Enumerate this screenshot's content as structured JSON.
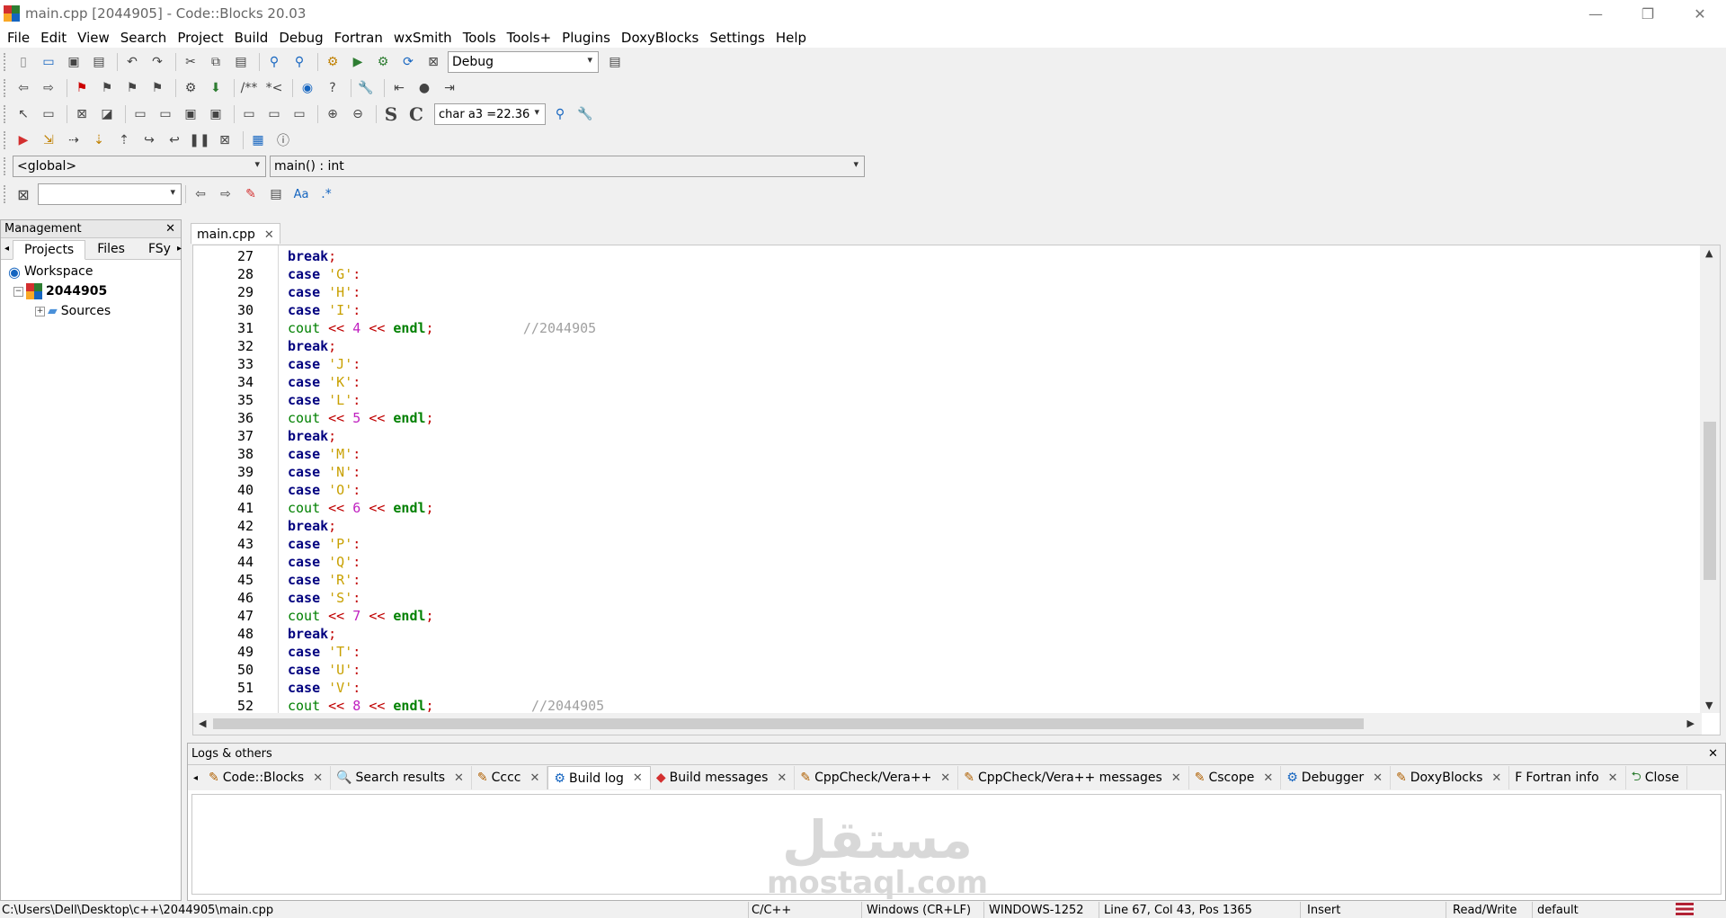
{
  "window": {
    "title": "main.cpp [2044905] - Code::Blocks 20.03",
    "controls": [
      "—",
      "❐",
      "✕"
    ]
  },
  "menu": [
    "File",
    "Edit",
    "View",
    "Search",
    "Project",
    "Build",
    "Debug",
    "Fortran",
    "wxSmith",
    "Tools",
    "Tools+",
    "Plugins",
    "DoxyBlocks",
    "Settings",
    "Help"
  ],
  "toolbar": {
    "build_target": "Debug",
    "debug_watch": "char a3  =22.36",
    "scope": "<global>",
    "function": "main() : int",
    "search_value": ""
  },
  "management": {
    "title": "Management",
    "tabs": [
      "Projects",
      "Files",
      "FSy"
    ],
    "active_tab": "Projects",
    "tree": {
      "workspace": "Workspace",
      "project": "2044905",
      "folder": "Sources"
    }
  },
  "editor": {
    "tab_label": "main.cpp",
    "lines": [
      {
        "n": "27",
        "tokens": [
          {
            "t": "break",
            "c": "kw"
          },
          {
            "t": ";",
            "c": "op"
          }
        ]
      },
      {
        "n": "28",
        "tokens": [
          {
            "t": "case",
            "c": "kw"
          },
          {
            "t": " "
          },
          {
            "t": "'G'",
            "c": "ch"
          },
          {
            "t": ":",
            "c": "op"
          }
        ]
      },
      {
        "n": "29",
        "tokens": [
          {
            "t": "case",
            "c": "kw"
          },
          {
            "t": " "
          },
          {
            "t": "'H'",
            "c": "ch"
          },
          {
            "t": ":",
            "c": "op"
          }
        ]
      },
      {
        "n": "30",
        "tokens": [
          {
            "t": "case",
            "c": "kw"
          },
          {
            "t": " "
          },
          {
            "t": "'I'",
            "c": "ch"
          },
          {
            "t": ":",
            "c": "op"
          }
        ]
      },
      {
        "n": "31",
        "tokens": [
          {
            "t": "cout",
            "c": "id"
          },
          {
            "t": " "
          },
          {
            "t": "<<",
            "c": "op"
          },
          {
            "t": " "
          },
          {
            "t": "4",
            "c": "num"
          },
          {
            "t": " "
          },
          {
            "t": "<<",
            "c": "op"
          },
          {
            "t": " "
          },
          {
            "t": "endl",
            "c": "idb"
          },
          {
            "t": ";",
            "c": "op"
          },
          {
            "t": "           "
          },
          {
            "t": "//2044905",
            "c": "cm"
          }
        ]
      },
      {
        "n": "32",
        "tokens": [
          {
            "t": "break",
            "c": "kw"
          },
          {
            "t": ";",
            "c": "op"
          }
        ]
      },
      {
        "n": "33",
        "tokens": [
          {
            "t": "case",
            "c": "kw"
          },
          {
            "t": " "
          },
          {
            "t": "'J'",
            "c": "ch"
          },
          {
            "t": ":",
            "c": "op"
          }
        ]
      },
      {
        "n": "34",
        "tokens": [
          {
            "t": "case",
            "c": "kw"
          },
          {
            "t": " "
          },
          {
            "t": "'K'",
            "c": "ch"
          },
          {
            "t": ":",
            "c": "op"
          }
        ]
      },
      {
        "n": "35",
        "tokens": [
          {
            "t": "case",
            "c": "kw"
          },
          {
            "t": " "
          },
          {
            "t": "'L'",
            "c": "ch"
          },
          {
            "t": ":",
            "c": "op"
          }
        ]
      },
      {
        "n": "36",
        "tokens": [
          {
            "t": "cout",
            "c": "id"
          },
          {
            "t": " "
          },
          {
            "t": "<<",
            "c": "op"
          },
          {
            "t": " "
          },
          {
            "t": "5",
            "c": "num"
          },
          {
            "t": " "
          },
          {
            "t": "<<",
            "c": "op"
          },
          {
            "t": " "
          },
          {
            "t": "endl",
            "c": "idb"
          },
          {
            "t": ";",
            "c": "op"
          }
        ]
      },
      {
        "n": "37",
        "tokens": [
          {
            "t": "break",
            "c": "kw"
          },
          {
            "t": ";",
            "c": "op"
          }
        ]
      },
      {
        "n": "38",
        "tokens": [
          {
            "t": "case",
            "c": "kw"
          },
          {
            "t": " "
          },
          {
            "t": "'M'",
            "c": "ch"
          },
          {
            "t": ":",
            "c": "op"
          }
        ]
      },
      {
        "n": "39",
        "tokens": [
          {
            "t": "case",
            "c": "kw"
          },
          {
            "t": " "
          },
          {
            "t": "'N'",
            "c": "ch"
          },
          {
            "t": ":",
            "c": "op"
          }
        ]
      },
      {
        "n": "40",
        "tokens": [
          {
            "t": "case",
            "c": "kw"
          },
          {
            "t": " "
          },
          {
            "t": "'O'",
            "c": "ch"
          },
          {
            "t": ":",
            "c": "op"
          }
        ]
      },
      {
        "n": "41",
        "tokens": [
          {
            "t": "cout",
            "c": "id"
          },
          {
            "t": " "
          },
          {
            "t": "<<",
            "c": "op"
          },
          {
            "t": " "
          },
          {
            "t": "6",
            "c": "num"
          },
          {
            "t": " "
          },
          {
            "t": "<<",
            "c": "op"
          },
          {
            "t": " "
          },
          {
            "t": "endl",
            "c": "idb"
          },
          {
            "t": ";",
            "c": "op"
          }
        ]
      },
      {
        "n": "42",
        "tokens": [
          {
            "t": "break",
            "c": "kw"
          },
          {
            "t": ";",
            "c": "op"
          }
        ]
      },
      {
        "n": "43",
        "tokens": [
          {
            "t": "case",
            "c": "kw"
          },
          {
            "t": " "
          },
          {
            "t": "'P'",
            "c": "ch"
          },
          {
            "t": ":",
            "c": "op"
          }
        ]
      },
      {
        "n": "44",
        "tokens": [
          {
            "t": "case",
            "c": "kw"
          },
          {
            "t": " "
          },
          {
            "t": "'Q'",
            "c": "ch"
          },
          {
            "t": ":",
            "c": "op"
          }
        ]
      },
      {
        "n": "45",
        "tokens": [
          {
            "t": "case",
            "c": "kw"
          },
          {
            "t": " "
          },
          {
            "t": "'R'",
            "c": "ch"
          },
          {
            "t": ":",
            "c": "op"
          }
        ]
      },
      {
        "n": "46",
        "tokens": [
          {
            "t": "case",
            "c": "kw"
          },
          {
            "t": " "
          },
          {
            "t": "'S'",
            "c": "ch"
          },
          {
            "t": ":",
            "c": "op"
          }
        ]
      },
      {
        "n": "47",
        "tokens": [
          {
            "t": "cout",
            "c": "id"
          },
          {
            "t": " "
          },
          {
            "t": "<<",
            "c": "op"
          },
          {
            "t": " "
          },
          {
            "t": "7",
            "c": "num"
          },
          {
            "t": " "
          },
          {
            "t": "<<",
            "c": "op"
          },
          {
            "t": " "
          },
          {
            "t": "endl",
            "c": "idb"
          },
          {
            "t": ";",
            "c": "op"
          }
        ]
      },
      {
        "n": "48",
        "tokens": [
          {
            "t": "break",
            "c": "kw"
          },
          {
            "t": ";",
            "c": "op"
          }
        ]
      },
      {
        "n": "49",
        "tokens": [
          {
            "t": "case",
            "c": "kw"
          },
          {
            "t": " "
          },
          {
            "t": "'T'",
            "c": "ch"
          },
          {
            "t": ":",
            "c": "op"
          }
        ]
      },
      {
        "n": "50",
        "tokens": [
          {
            "t": "case",
            "c": "kw"
          },
          {
            "t": " "
          },
          {
            "t": "'U'",
            "c": "ch"
          },
          {
            "t": ":",
            "c": "op"
          }
        ]
      },
      {
        "n": "51",
        "tokens": [
          {
            "t": "case",
            "c": "kw"
          },
          {
            "t": " "
          },
          {
            "t": "'V'",
            "c": "ch"
          },
          {
            "t": ":",
            "c": "op"
          }
        ]
      },
      {
        "n": "52",
        "tokens": [
          {
            "t": "cout",
            "c": "id"
          },
          {
            "t": " "
          },
          {
            "t": "<<",
            "c": "op"
          },
          {
            "t": " "
          },
          {
            "t": "8",
            "c": "num"
          },
          {
            "t": " "
          },
          {
            "t": "<<",
            "c": "op"
          },
          {
            "t": " "
          },
          {
            "t": "endl",
            "c": "idb"
          },
          {
            "t": ";",
            "c": "op"
          },
          {
            "t": "            "
          },
          {
            "t": "//2044905",
            "c": "cm"
          }
        ]
      }
    ]
  },
  "logs": {
    "title": "Logs & others",
    "tabs": [
      {
        "label": "Code::Blocks",
        "icon": "✎"
      },
      {
        "label": "Search results",
        "icon": "🔍"
      },
      {
        "label": "Cccc",
        "icon": "✎"
      },
      {
        "label": "Build log",
        "icon": "⚙",
        "active": true
      },
      {
        "label": "Build messages",
        "icon": "◆"
      },
      {
        "label": "CppCheck/Vera++",
        "icon": "✎"
      },
      {
        "label": "CppCheck/Vera++ messages",
        "icon": "✎"
      },
      {
        "label": "Cscope",
        "icon": "✎"
      },
      {
        "label": "Debugger",
        "icon": "⚙"
      },
      {
        "label": "DoxyBlocks",
        "icon": "✎"
      },
      {
        "label": "Fortran info",
        "icon": "F"
      },
      {
        "label": "Close",
        "icon": "⮌"
      }
    ],
    "watermark_ar": "مستقل",
    "watermark_en": "mostaql.com"
  },
  "status": {
    "path": "C:\\Users\\Dell\\Desktop\\c++\\2044905\\main.cpp",
    "language": "C/C++",
    "eol": "Windows (CR+LF)",
    "encoding": "WINDOWS-1252",
    "position": "Line 67, Col 43, Pos 1365",
    "mode": "Insert",
    "access": "Read/Write",
    "profile": "default"
  },
  "colors": {
    "keyword": "#00007f",
    "char_literal": "#c8a000",
    "number": "#c020c0",
    "operator": "#c00000",
    "identifier": "#008000",
    "comment": "#a0a0a0"
  }
}
